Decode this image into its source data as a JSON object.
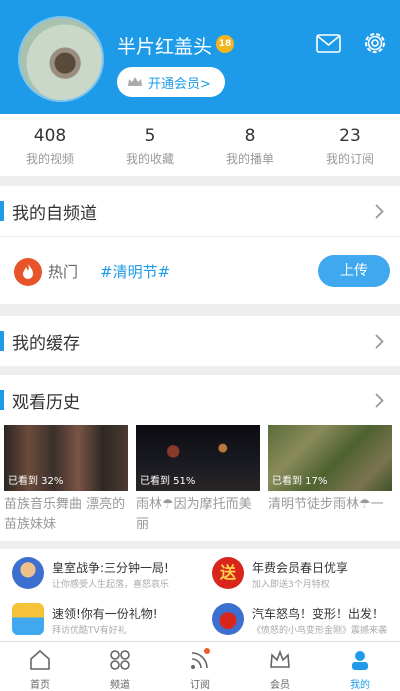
{
  "header": {
    "username": "半片红盖头",
    "vip_badge": "18",
    "vip_button": "开通会员>"
  },
  "stats": [
    {
      "count": "408",
      "label": "我的视频"
    },
    {
      "count": "5",
      "label": "我的收藏"
    },
    {
      "count": "8",
      "label": "我的播单"
    },
    {
      "count": "23",
      "label": "我的订阅"
    }
  ],
  "channel": {
    "title": "我的自频道",
    "hot_label": "热门",
    "tag": "#清明节#",
    "upload": "上传"
  },
  "cache": {
    "title": "我的缓存"
  },
  "history": {
    "title": "观看历史",
    "items": [
      {
        "progress": "已看到 32%",
        "title": "苗族音乐舞曲 漂亮的苗族妹妹"
      },
      {
        "progress": "已看到 51%",
        "title": "雨林☂因为摩托而美丽"
      },
      {
        "progress": "已看到 17%",
        "title": "清明节徒步雨林☂一"
      }
    ]
  },
  "ads": [
    {
      "title": "皇室战争:三分钟一局!",
      "sub": "让你感受人生起落，喜怒哀乐"
    },
    {
      "title": "年费会员春日优享",
      "sub": "加入即送3个月特权"
    },
    {
      "title": "速领!你有一份礼物!",
      "sub": "拜访优酷TV有好礼"
    },
    {
      "title": "汽车怒鸟！变形！出发！",
      "sub": "《愤怒的小鸟变形金刚》震撼来袭"
    }
  ],
  "tabs": [
    {
      "label": "首页"
    },
    {
      "label": "频道"
    },
    {
      "label": "订阅"
    },
    {
      "label": "会员"
    },
    {
      "label": "我的"
    }
  ],
  "colors": {
    "accent": "#1e9be8",
    "vip_gold": "#f2b51c",
    "upload": "#3fa8ee"
  }
}
